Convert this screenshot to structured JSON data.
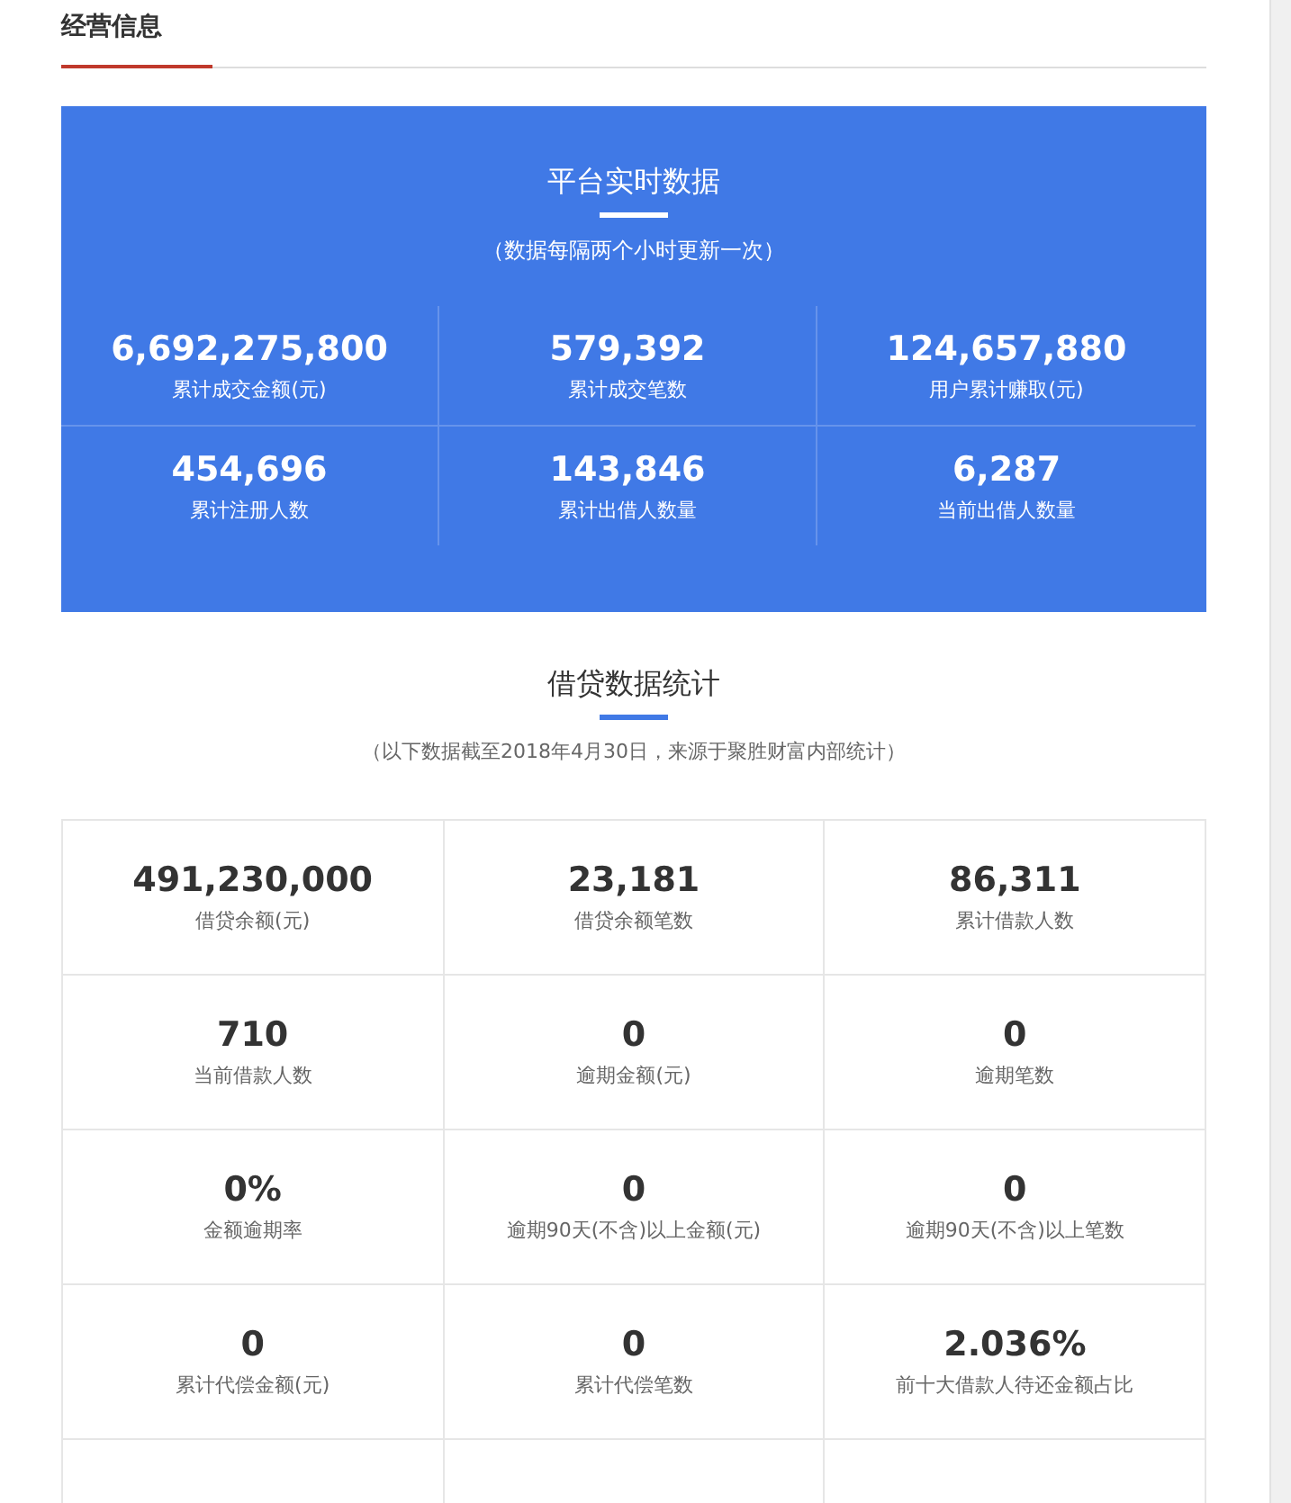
{
  "section_title": "经营信息",
  "platform": {
    "title": "平台实时数据",
    "subtitle": "（数据每隔两个小时更新一次）",
    "stats": [
      {
        "value": "6,692,275,800",
        "label": "累计成交金额(元)"
      },
      {
        "value": "579,392",
        "label": "累计成交笔数"
      },
      {
        "value": "124,657,880",
        "label": "用户累计赚取(元)"
      },
      {
        "value": "454,696",
        "label": "累计注册人数"
      },
      {
        "value": "143,846",
        "label": "累计出借人数量"
      },
      {
        "value": "6,287",
        "label": "当前出借人数量"
      }
    ]
  },
  "loan": {
    "title": "借贷数据统计",
    "subtitle": "（以下数据截至2018年4月30日，来源于聚胜财富内部统计）",
    "stats": [
      {
        "value": "491,230,000",
        "label": "借贷余额(元)"
      },
      {
        "value": "23,181",
        "label": "借贷余额笔数"
      },
      {
        "value": "86,311",
        "label": "累计借款人数"
      },
      {
        "value": "710",
        "label": "当前借款人数"
      },
      {
        "value": "0",
        "label": "逾期金额(元)"
      },
      {
        "value": "0",
        "label": "逾期笔数"
      },
      {
        "value": "0%",
        "label": "金额逾期率"
      },
      {
        "value": "0",
        "label": "逾期90天(不含)以上金额(元)"
      },
      {
        "value": "0",
        "label": "逾期90天(不含)以上笔数"
      },
      {
        "value": "0",
        "label": "累计代偿金额(元)"
      },
      {
        "value": "0",
        "label": "累计代偿笔数"
      },
      {
        "value": "2.036%",
        "label": "前十大借款人待还金额占比"
      }
    ]
  }
}
